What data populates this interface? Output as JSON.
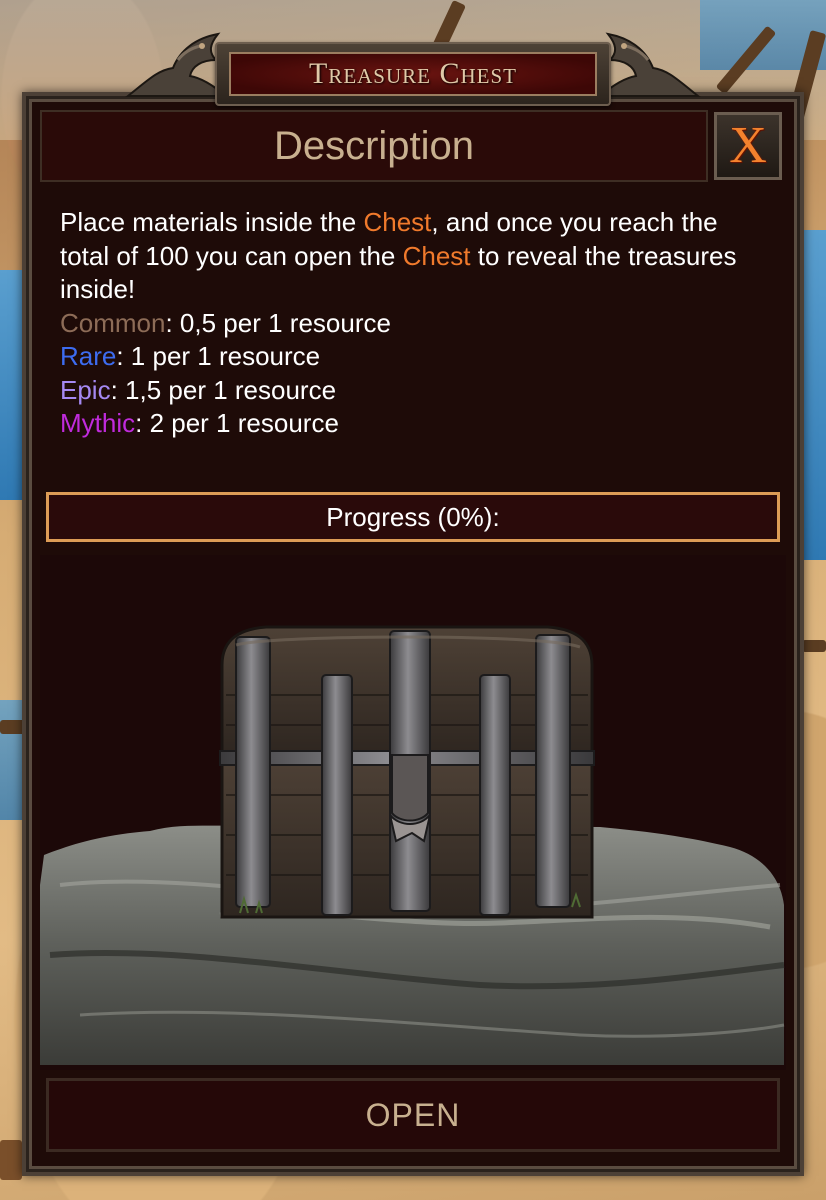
{
  "window": {
    "banner_title": "Treasure Chest",
    "header_title": "Description",
    "close_label": "X"
  },
  "description": {
    "intro_1": "Place materials inside the ",
    "chest_word_1": "Chest",
    "intro_2": ", and once you reach the total of 100 you can open the ",
    "chest_word_2": "Chest",
    "intro_3": " to reveal the treasures inside!",
    "rarities": [
      {
        "name": "Common",
        "rate": ": 0,5 per 1 resource",
        "color": "#8d6c57"
      },
      {
        "name": "Rare",
        "rate": ": 1 per 1 resource",
        "color": "#3d6cf0"
      },
      {
        "name": "Epic",
        "rate": ": 1,5 per 1 resource",
        "color": "#a589f2"
      },
      {
        "name": "Mythic",
        "rate": ": 2 per 1 resource",
        "color": "#c02bdc"
      }
    ]
  },
  "progress": {
    "label": "Progress (0%):",
    "value": 0
  },
  "actions": {
    "open_label": "OPEN"
  },
  "colors": {
    "accent": "#f07a2c",
    "text": "#c8b08f",
    "panel": "#1e0b08",
    "progress_border": "#dd9c56"
  }
}
